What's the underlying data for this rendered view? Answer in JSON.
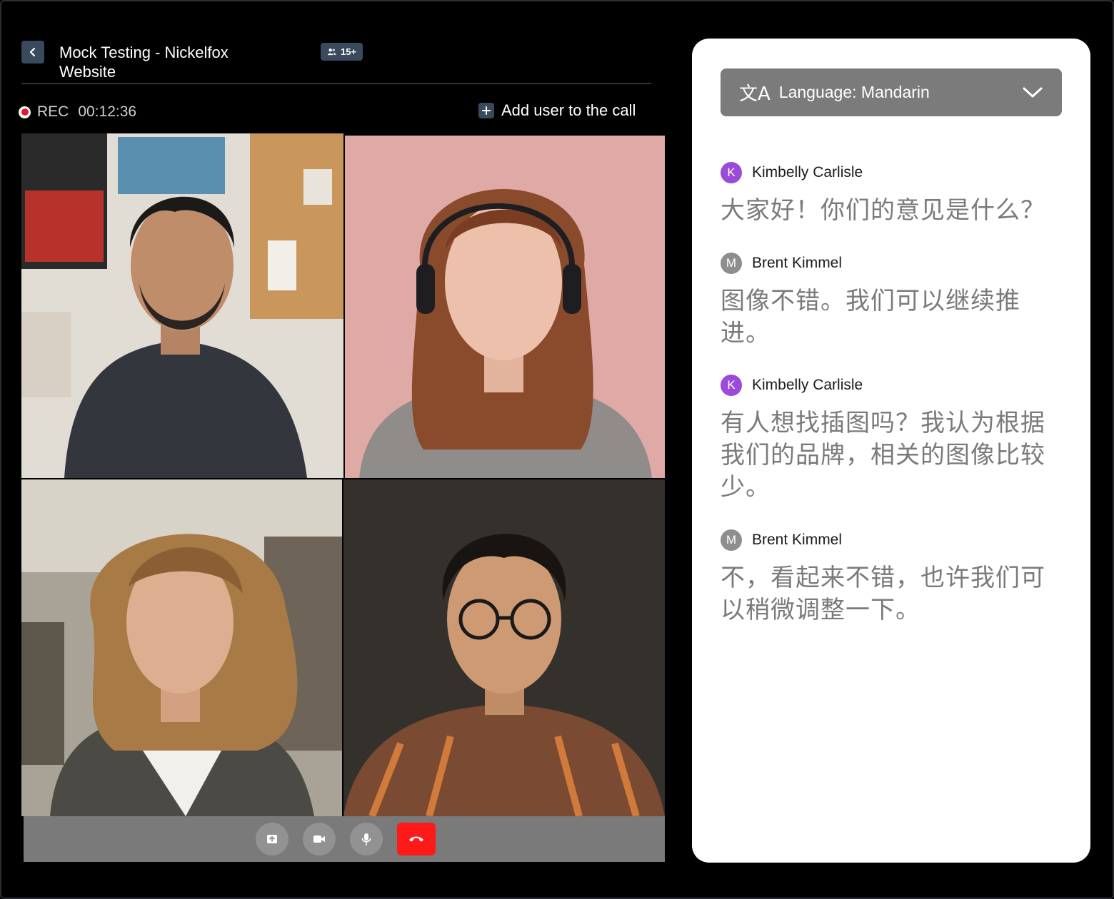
{
  "meeting": {
    "title": "Mock Testing - Nickelfox Website",
    "participants_count": "15+",
    "rec_label": "REC",
    "rec_time": "00:12:36",
    "add_user_label": "Add user to the call"
  },
  "controls": {
    "share_icon": "upload-icon",
    "video_icon": "video-icon",
    "mic_icon": "mic-icon",
    "end_icon": "phone-hangup-icon",
    "end_color": "#ff1a1a"
  },
  "transcript": {
    "language_label": "Language: Mandarin",
    "language_icon": "文A",
    "messages": [
      {
        "initial": "K",
        "name": "Kimbelly Carlisle",
        "text": "大家好！你们的意见是什么？"
      },
      {
        "initial": "M",
        "name": "Brent Kimmel",
        "text": "图像不错。我们可以继续推进。"
      },
      {
        "initial": "K",
        "name": "Kimbelly Carlisle",
        "text": "有人想找插图吗？我认为根据我们的品牌，相关的图像比较少。"
      },
      {
        "initial": "M",
        "name": "Brent Kimmel",
        "text": "不，看起来不错，也许我们可以稍微调整一下。"
      }
    ]
  },
  "colors": {
    "accent": "#3a4a5e",
    "avatar_k": "#9a4bd8",
    "avatar_m": "#8e8e8e",
    "rec": "#e5172b"
  }
}
